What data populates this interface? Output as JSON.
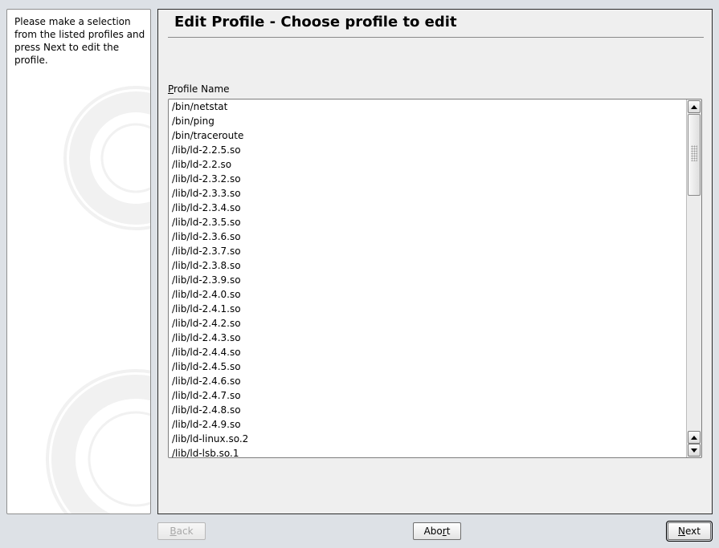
{
  "help": {
    "text": "Please make a selection from the listed profiles and press Next to edit the profile."
  },
  "header": {
    "title": "Edit Profile - Choose profile to edit"
  },
  "profile_list": {
    "label_mnemonic": "P",
    "label_rest": "rofile Name",
    "items": [
      "/bin/netstat",
      "/bin/ping",
      "/bin/traceroute",
      "/lib/ld-2.2.5.so",
      "/lib/ld-2.2.so",
      "/lib/ld-2.3.2.so",
      "/lib/ld-2.3.3.so",
      "/lib/ld-2.3.4.so",
      "/lib/ld-2.3.5.so",
      "/lib/ld-2.3.6.so",
      "/lib/ld-2.3.7.so",
      "/lib/ld-2.3.8.so",
      "/lib/ld-2.3.9.so",
      "/lib/ld-2.4.0.so",
      "/lib/ld-2.4.1.so",
      "/lib/ld-2.4.2.so",
      "/lib/ld-2.4.3.so",
      "/lib/ld-2.4.4.so",
      "/lib/ld-2.4.5.so",
      "/lib/ld-2.4.6.so",
      "/lib/ld-2.4.7.so",
      "/lib/ld-2.4.8.so",
      "/lib/ld-2.4.9.so",
      "/lib/ld-linux.so.2",
      "/lib/ld-lsb.so.1"
    ]
  },
  "buttons": {
    "back_mnemonic": "B",
    "back_rest": "ack",
    "abort_before": "Abo",
    "abort_mnemonic": "r",
    "abort_after": "t",
    "next_mnemonic": "N",
    "next_rest": "ext"
  }
}
